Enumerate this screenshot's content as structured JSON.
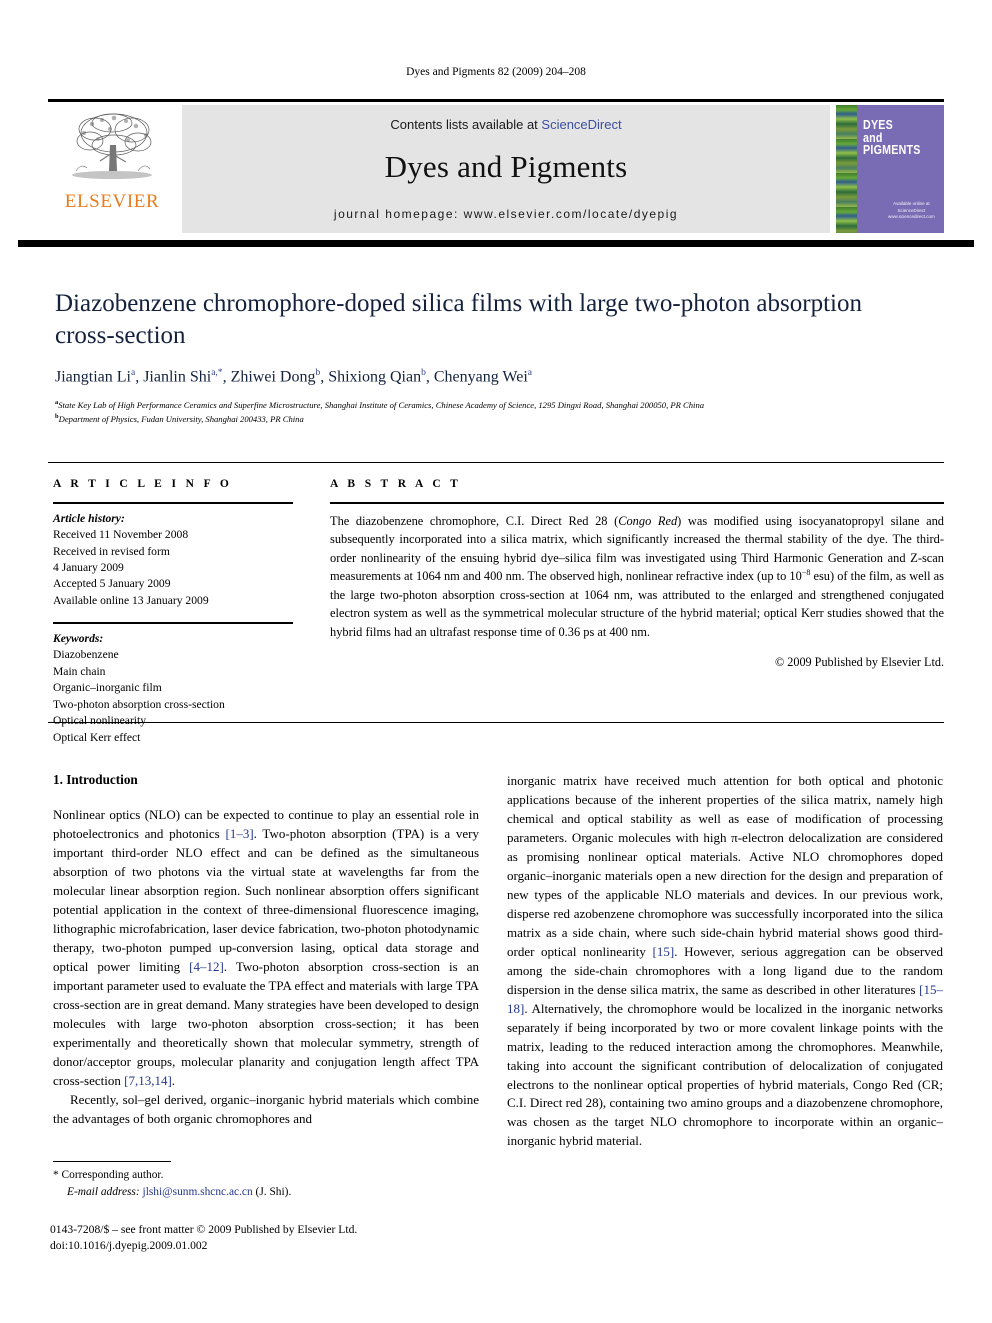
{
  "running_head": "Dyes and Pigments 82 (2009) 204–208",
  "header": {
    "contents_prefix": "Contents lists available at ",
    "sciencedirect": "ScienceDirect",
    "journal_title": "Dyes and Pigments",
    "homepage": "journal homepage: www.elsevier.com/locate/dyepig",
    "publisher_wordmark": "ELSEVIER",
    "cover": {
      "line1": "DYES",
      "line2": "and",
      "line3": "PIGMENTS",
      "sd_note": "Available online at",
      "sd_brand": "ScienceDirect",
      "sd_url": "www.sciencedirect.com"
    },
    "accent_orange": "#E87C1E",
    "link_blue": "#3c4fa0",
    "band_gray": "#e4e4e4",
    "cover_purple": "#7a6bb5"
  },
  "article": {
    "title": "Diazobenzene chromophore-doped silica films with large two-photon absorption cross-section",
    "authors": [
      {
        "name": "Jiangtian Li",
        "sup": "a"
      },
      {
        "name": "Jianlin Shi",
        "sup": "a,*"
      },
      {
        "name": "Zhiwei Dong",
        "sup": "b"
      },
      {
        "name": "Shixiong Qian",
        "sup": "b"
      },
      {
        "name": "Chenyang Wei",
        "sup": "a"
      }
    ],
    "affiliations": [
      {
        "sup": "a",
        "text": "State Key Lab of High Performance Ceramics and Superfine Microstructure, Shanghai Institute of Ceramics, Chinese Academy of Science, 1295 Dingxi Road, Shanghai 200050, PR China"
      },
      {
        "sup": "b",
        "text": "Department of Physics, Fudan University, Shanghai 200433, PR China"
      }
    ],
    "title_color": "#14213d"
  },
  "info": {
    "heading": "A R T I C L E   I N F O",
    "history_label": "Article history:",
    "history": [
      "Received 11 November 2008",
      "Received in revised form",
      "4 January 2009",
      "Accepted 5 January 2009",
      "Available online 13 January 2009"
    ],
    "keywords_label": "Keywords:",
    "keywords": [
      "Diazobenzene",
      "Main chain",
      "Organic–inorganic film",
      "Two-photon absorption cross-section",
      "Optical nonlinearity",
      "Optical Kerr effect"
    ]
  },
  "abstract": {
    "heading": "A B S T R A C T",
    "part1": "The diazobenzene chromophore, C.I. Direct Red 28 (",
    "italic1": "Congo Red",
    "part2": ") was modified using isocyanatopropyl silane and subsequently incorporated into a silica matrix, which significantly increased the thermal stability of the dye. The third-order nonlinearity of the ensuing hybrid dye–silica film was investigated using Third Harmonic Generation and Z-scan measurements at 1064 nm and 400 nm. The observed high, nonlinear refractive index (up to 10",
    "sup1": "−8",
    "part3": " esu) of the film, as well as the large two-photon absorption cross-section at 1064 nm, was attributed to the enlarged and strengthened conjugated electron system as well as the symmetrical molecular structure of the hybrid material; optical Kerr studies showed that the hybrid films had an ultrafast response time of 0.36 ps at 400 nm.",
    "copyright": "© 2009 Published by Elsevier Ltd."
  },
  "introduction": {
    "heading": "1. Introduction",
    "left": {
      "p1_a": "Nonlinear optics (NLO) can be expected to continue to play an essential role in photoelectronics and photonics ",
      "c1": "[1–3]",
      "p1_b": ". Two-photon absorption (TPA) is a very important third-order NLO effect and can be defined as the simultaneous absorption of two photons via the virtual state at wavelengths far from the molecular linear absorption region. Such nonlinear absorption offers significant potential application in the context of three-dimensional fluorescence imaging, lithographic microfabrication, laser device fabrication, two-photon photodynamic therapy, two-photon pumped up-conversion lasing, optical data storage and optical power limiting ",
      "c2": "[4–12]",
      "p1_c": ". Two-photon absorption cross-section is an important parameter used to evaluate the TPA effect and materials with large TPA cross-section are in great demand. Many strategies have been developed to design molecules with large two-photon absorption cross-section; it has been experimentally and theoretically shown that molecular symmetry, strength of donor/acceptor groups, molecular planarity and conjugation length affect TPA cross-section ",
      "c3": "[7,13,14]",
      "p1_d": ".",
      "p2": "Recently, sol–gel derived, organic–inorganic hybrid materials which combine the advantages of both organic chromophores and"
    },
    "right": {
      "p1_a": "inorganic matrix have received much attention for both optical and photonic applications because of the inherent properties of the silica matrix, namely high chemical and optical stability as well as ease of modification of processing parameters. Organic molecules with high π-electron delocalization are considered as promising nonlinear optical materials. Active NLO chromophores doped organic–inorganic materials open a new direction for the design and preparation of new types of the applicable NLO materials and devices. In our previous work, disperse red azobenzene chromophore was successfully incorporated into the silica matrix as a side chain, where such side-chain hybrid material shows good third-order optical nonlinearity ",
      "c1": "[15]",
      "p1_b": ". However, serious aggregation can be observed among the side-chain chromophores with a long ligand due to the random dispersion in the dense silica matrix, the same as described in other literatures ",
      "c2": "[15–18]",
      "p1_c": ". Alternatively, the chromophore would be localized in the inorganic networks separately if being incorporated by two or more covalent linkage points with the matrix, leading to the reduced interaction among the chromophores. Meanwhile, taking into account the significant contribution of delocalization of conjugated electrons to the nonlinear optical properties of hybrid materials, Congo Red (CR; C.I. Direct red 28), containing two amino groups and a diazobenzene chromophore, was chosen as the target NLO chromophore to incorporate within an organic–inorganic hybrid material."
    },
    "cite_color": "#23368c"
  },
  "footer": {
    "corresponding": "* Corresponding author.",
    "email_label": "E-mail address:",
    "email": "jlshi@sunm.shcnc.ac.cn",
    "email_suffix": "(J. Shi).",
    "issn_line": "0143-7208/$ – see front matter © 2009 Published by Elsevier Ltd.",
    "doi_line": "doi:10.1016/j.dyepig.2009.01.002"
  }
}
